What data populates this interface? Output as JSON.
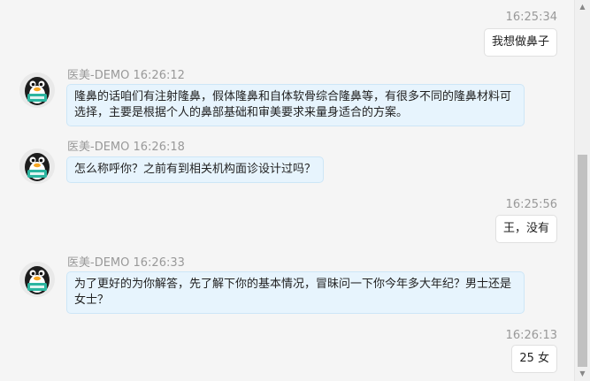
{
  "messages": [
    {
      "side": "right",
      "time": "16:25:34",
      "text": "我想做鼻子"
    },
    {
      "side": "left",
      "sender": "医美-DEMO 16:26:12",
      "lines": [
        "隆鼻的话咱们有注射隆鼻，假体隆鼻和自体软骨综合隆鼻等，有很多不同的隆鼻材料可",
        "选择，主要是根据个人的鼻部基础和审美要求来量身适合的方案。"
      ]
    },
    {
      "side": "left",
      "sender": "医美-DEMO 16:26:18",
      "lines": [
        "怎么称呼你？之前有到相关机构面诊设计过吗？"
      ]
    },
    {
      "side": "right",
      "time": "16:25:56",
      "text": "王，没有"
    },
    {
      "side": "left",
      "sender": "医美-DEMO 16:26:33",
      "lines": [
        "为了更好的为你解答，先了解下你的基本情况，冒昧问一下你今年多大年纪？男士还是",
        "女士？"
      ]
    },
    {
      "side": "right",
      "time": "16:26:13",
      "text": "25 女"
    }
  ],
  "avatar_badge_color": "#2bb5a0"
}
